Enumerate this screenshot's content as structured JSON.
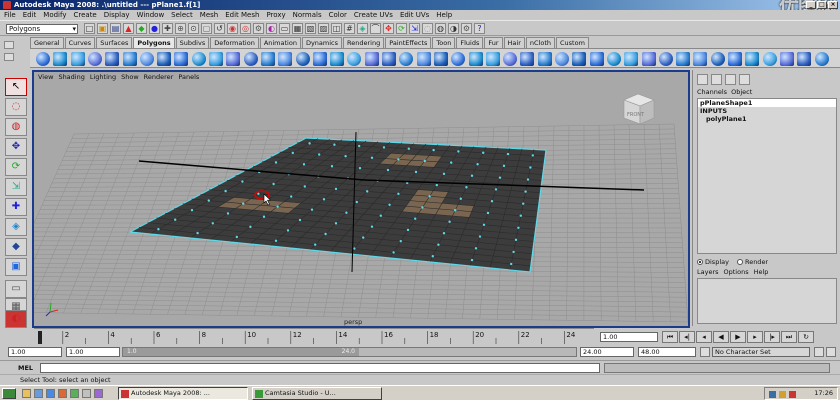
{
  "window": {
    "title": "Autodesk Maya 2008: .\\untitled  ---  pPlane1.f[1]",
    "controls": [
      "_",
      "□",
      "×"
    ],
    "watermark": "优图网"
  },
  "menu": [
    "File",
    "Edit",
    "Modify",
    "Create",
    "Display",
    "Window",
    "Select",
    "Mesh",
    "Edit Mesh",
    "Proxy",
    "Normals",
    "Color",
    "Create UVs",
    "Edit UVs",
    "Help"
  ],
  "status_line": {
    "mode": "Polygons"
  },
  "shelf": {
    "tabs": [
      "General",
      "Curves",
      "Surfaces",
      "Polygons",
      "Subdivs",
      "Deformation",
      "Animation",
      "Dynamics",
      "Rendering",
      "PaintEffects",
      "Toon",
      "Fluids",
      "Fur",
      "Hair",
      "nCloth",
      "Custom"
    ],
    "active_tab": "Polygons"
  },
  "viewport": {
    "menu": [
      "View",
      "Shading",
      "Lighting",
      "Show",
      "Renderer",
      "Panels"
    ],
    "camera_label": "persp",
    "viewcube_label": "FRONT"
  },
  "channel_box": {
    "tabs": [
      "Channels",
      "Object"
    ],
    "shape": "pPlaneShape1",
    "inputs_label": "INPUTS",
    "input_node": "polyPlane1",
    "display_label": "Display",
    "render_label": "Render",
    "layer_menu": [
      "Layers",
      "Options",
      "Help"
    ]
  },
  "time_slider": {
    "ticks": [
      "2",
      "4",
      "6",
      "8",
      "10",
      "12",
      "14",
      "16",
      "18",
      "20",
      "22",
      "24"
    ],
    "current_frame": "1.00"
  },
  "range_slider": {
    "start": "1.00",
    "playback_start": "1.00",
    "range_start_label": "1.0",
    "range_end_label": "24.0",
    "playback_end": "24.00",
    "end": "48.00",
    "character_set": "No Character Set"
  },
  "command_line": {
    "label": "MEL"
  },
  "help_line": "Select Tool: select an object",
  "taskbar": {
    "tasks": [
      "Autodesk Maya 2008: ...",
      "Camtasia Studio - U..."
    ],
    "clock": "17:26"
  },
  "colors": {
    "viewport_bg": "#a8a8a8",
    "mesh_dark": "#3c3c3c",
    "mesh_highlight": "#7a6650",
    "wire_cyan": "#5fd8e8",
    "title_blue": "#0a246a"
  }
}
